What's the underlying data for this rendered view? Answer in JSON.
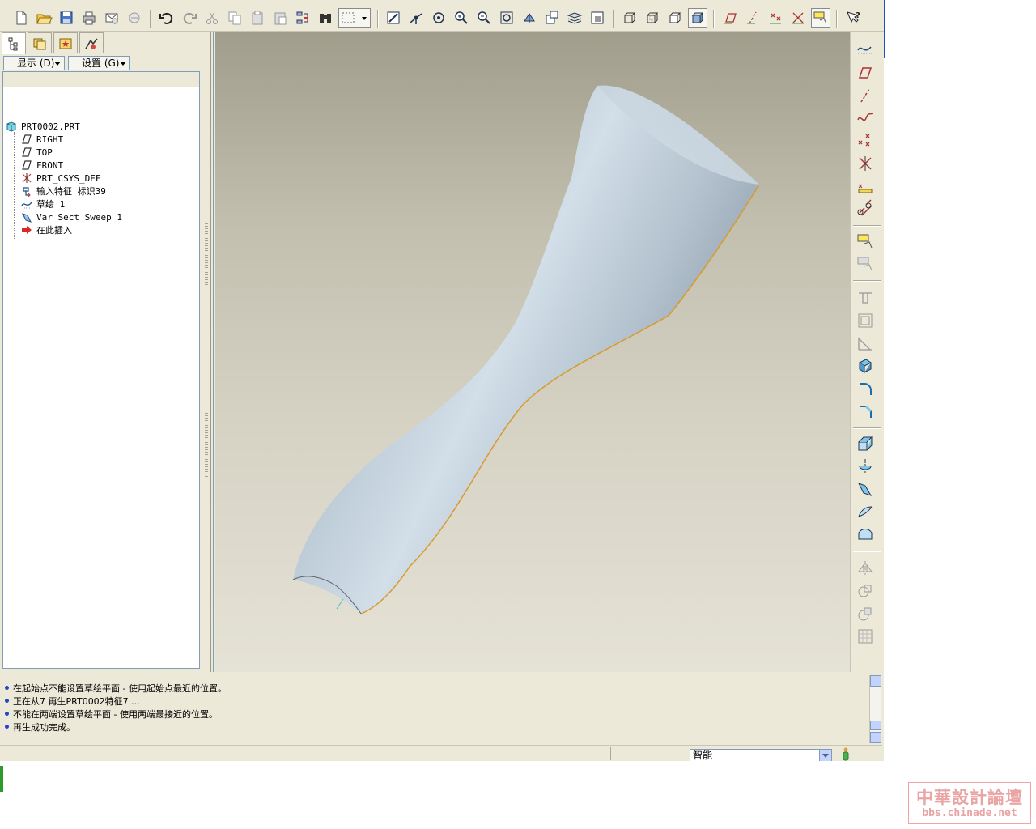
{
  "navigator": {
    "show_menu": "显示 (D)",
    "settings_menu": "设置 (G)"
  },
  "model_tree": [
    {
      "label": "PRT0002.PRT",
      "icon": "part-icon"
    },
    {
      "label": "RIGHT",
      "icon": "datum-plane-icon"
    },
    {
      "label": "TOP",
      "icon": "datum-plane-icon"
    },
    {
      "label": "FRONT",
      "icon": "datum-plane-icon"
    },
    {
      "label": "PRT_CSYS_DEF",
      "icon": "csys-icon"
    },
    {
      "label": "输入特征 标识39",
      "icon": "import-feature-icon"
    },
    {
      "label": "草绘 1",
      "icon": "sketch-icon"
    },
    {
      "label": "Var Sect Sweep 1",
      "icon": "var-sect-sweep-icon"
    },
    {
      "label": "在此插入",
      "icon": "insert-here-arrow-icon"
    }
  ],
  "messages": [
    "在起始点不能设置草绘平面 - 使用起始点最近的位置。",
    "正在从7 再生PRT0002特征7 ...",
    "不能在两端设置草绘平面 - 使用两端最接近的位置。",
    "再生成功完成。"
  ],
  "status": {
    "filter_value": "智能"
  },
  "watermark": {
    "title": "中華設計論壇",
    "url": "bbs.chinade.net"
  },
  "colors": {
    "window_bg": "#ece9d8",
    "accent_blue": "#1f46c8",
    "model_surface": "#b7c6d2",
    "model_edge": "#e0a030"
  }
}
